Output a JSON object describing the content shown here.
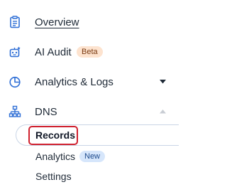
{
  "nav": {
    "overview": {
      "label": "Overview",
      "icon": "clipboard-icon"
    },
    "ai_audit": {
      "label": "AI Audit",
      "badge": "Beta",
      "icon": "robot-icon"
    },
    "analytics_logs": {
      "label": "Analytics & Logs",
      "icon": "pie-chart-icon",
      "chevron": "chevron-down-icon"
    },
    "dns": {
      "label": "DNS",
      "icon": "network-icon",
      "chevron": "chevron-up-icon",
      "sub_items": [
        {
          "label": "Records",
          "active": true
        },
        {
          "label": "Analytics",
          "badge": "New"
        },
        {
          "label": "Settings"
        }
      ]
    }
  },
  "colors": {
    "accent_blue": "#2f6fd6",
    "beta_badge_bg": "#fde3cf",
    "new_badge_bg": "#d6e6fb",
    "highlight_red": "#d0202e"
  }
}
